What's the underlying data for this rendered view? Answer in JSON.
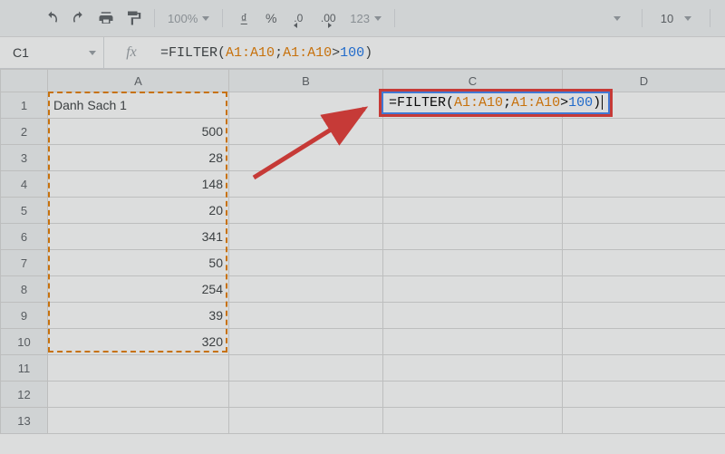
{
  "toolbar": {
    "zoom": "100%",
    "currency_icon": "₫",
    "percent": "%",
    "dec_dec": ".0",
    "dec_inc": ".00",
    "more_formats": "123",
    "font_size": "10"
  },
  "namebox": "C1",
  "fx_label": "fx",
  "formula_parts": {
    "eq": "=",
    "fn": "FILTER",
    "open": "(",
    "r1": "A1:A10",
    "sep": ";",
    "r2": "A1:A10",
    "gt": ">",
    "num": "100",
    "close": ")"
  },
  "columns": [
    "A",
    "B",
    "C",
    "D"
  ],
  "rows": [
    "1",
    "2",
    "3",
    "4",
    "5",
    "6",
    "7",
    "8",
    "9",
    "10",
    "11",
    "12",
    "13"
  ],
  "cells": {
    "A1": {
      "text": "Danh Sach 1",
      "type": "txt"
    },
    "A2": {
      "text": "500",
      "type": "num"
    },
    "A3": {
      "text": "28",
      "type": "num"
    },
    "A4": {
      "text": "148",
      "type": "num"
    },
    "A5": {
      "text": "20",
      "type": "num"
    },
    "A6": {
      "text": "341",
      "type": "num"
    },
    "A7": {
      "text": "50",
      "type": "num"
    },
    "A8": {
      "text": "254",
      "type": "num"
    },
    "A9": {
      "text": "39",
      "type": "num"
    },
    "A10": {
      "text": "320",
      "type": "num"
    }
  }
}
